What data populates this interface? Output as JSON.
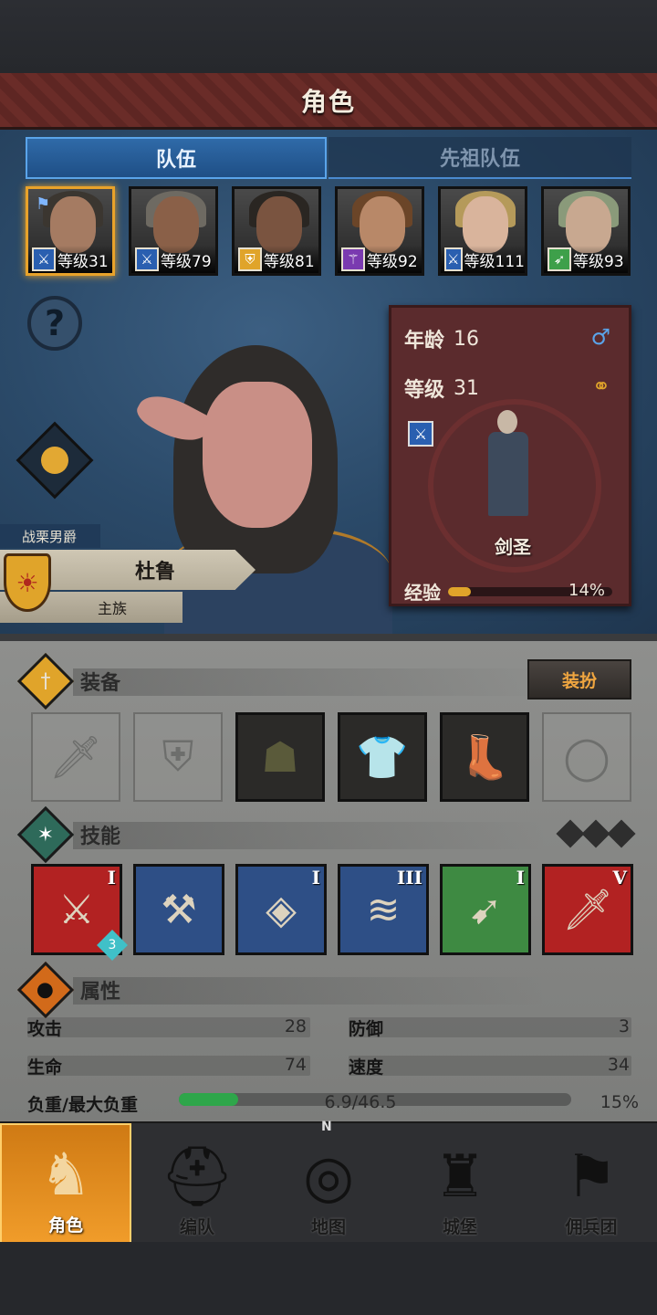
{
  "header": {
    "title": "角色"
  },
  "tabs": [
    {
      "label": "队伍",
      "active": true
    },
    {
      "label": "先祖队伍",
      "active": false
    }
  ],
  "party": [
    {
      "level": "等级31",
      "class_color": "#2a5fb0",
      "class_icon": "sword-icon",
      "selected": true
    },
    {
      "level": "等级79",
      "class_color": "#2a5fb0",
      "class_icon": "sword-icon",
      "selected": false
    },
    {
      "level": "等级81",
      "class_color": "#e0a42a",
      "class_icon": "shield-icon",
      "selected": false
    },
    {
      "level": "等级92",
      "class_color": "#7a3ab0",
      "class_icon": "staff-icon",
      "selected": false
    },
    {
      "level": "等级111",
      "class_color": "#2a5fb0",
      "class_icon": "sword-icon",
      "selected": false
    },
    {
      "level": "等级93",
      "class_color": "#3ea04a",
      "class_icon": "bow-icon",
      "selected": false
    }
  ],
  "character": {
    "title": "战栗男爵",
    "name": "杜鲁",
    "house": "主族",
    "age_label": "年龄",
    "age": "16",
    "level_label": "等级",
    "level": "31",
    "class_name": "剑圣",
    "exp_label": "经验",
    "exp_percent": "14%",
    "exp_fraction": 0.14
  },
  "equipment": {
    "title": "装备",
    "dress_button": "装扮",
    "slots": [
      {
        "name": "weapon-slot",
        "icon": "sword-icon",
        "filled": false
      },
      {
        "name": "offhand-slot",
        "icon": "shield-icon",
        "filled": false
      },
      {
        "name": "head-slot",
        "icon": "hood-icon",
        "filled": true
      },
      {
        "name": "body-slot",
        "icon": "tunic-icon",
        "filled": true
      },
      {
        "name": "legs-slot",
        "icon": "boots-icon",
        "filled": true
      },
      {
        "name": "ring-slot",
        "icon": "ring-icon",
        "filled": false
      }
    ]
  },
  "skills": {
    "title": "技能",
    "items": [
      {
        "rank": "I",
        "color": "#b22222",
        "stack": "3"
      },
      {
        "rank": "",
        "color": "#2e4f86",
        "stack": ""
      },
      {
        "rank": "I",
        "color": "#2e4f86",
        "stack": ""
      },
      {
        "rank": "III",
        "color": "#2e4f86",
        "stack": ""
      },
      {
        "rank": "I",
        "color": "#3e8a42",
        "stack": ""
      },
      {
        "rank": "V",
        "color": "#b22222",
        "stack": ""
      }
    ]
  },
  "attributes": {
    "title": "属性",
    "attack_label": "攻击",
    "attack": "28",
    "defense_label": "防御",
    "defense": "3",
    "hp_label": "生命",
    "hp": "74",
    "speed_label": "速度",
    "speed": "34",
    "load_label": "负重/最大负重",
    "load": "6.9/46.5",
    "load_percent": "15%",
    "load_fraction": 0.15
  },
  "nav": [
    {
      "label": "角色",
      "icon": "knight-icon",
      "active": true
    },
    {
      "label": "编队",
      "icon": "helmet-icon",
      "active": false
    },
    {
      "label": "地图",
      "icon": "compass-icon",
      "active": false
    },
    {
      "label": "城堡",
      "icon": "castle-icon",
      "active": false
    },
    {
      "label": "佣兵团",
      "icon": "mercenary-icon",
      "active": false
    }
  ],
  "compass_north": "N"
}
